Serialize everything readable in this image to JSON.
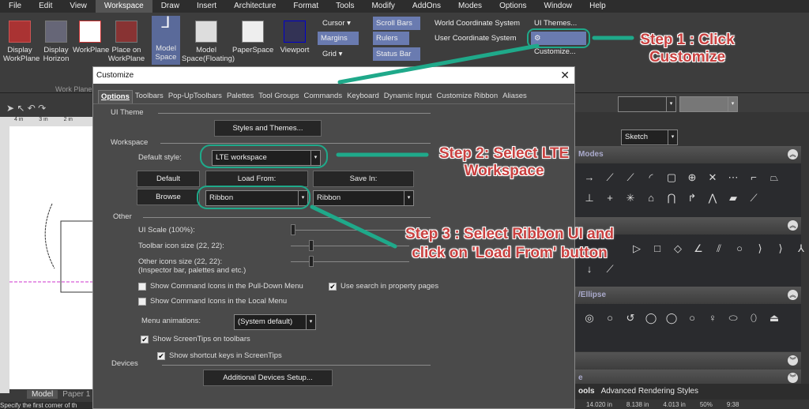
{
  "menubar": [
    "File",
    "Edit",
    "View",
    "Workspace",
    "Draw",
    "Insert",
    "Architecture",
    "Format",
    "Tools",
    "Modify",
    "AddOns",
    "Modes",
    "Options",
    "Window",
    "Help"
  ],
  "menubar_active": "Workspace",
  "ribbon": {
    "workplane_buttons": [
      "Display WorkPlane",
      "Display Horizon",
      "WorkPlane",
      "Place on WorkPlane"
    ],
    "group_label": "Work Plane",
    "space_buttons": [
      "Model Space",
      "Model Space(Floating)",
      "PaperSpace",
      "Viewport"
    ],
    "small": {
      "cursor": "Cursor",
      "margins": "Margins",
      "grid": "Grid",
      "scroll_bars": "Scroll Bars",
      "rulers": "Rulers",
      "status_bar": "Status Bar",
      "wcs": "World Coordinate System",
      "ucs": "User Coordinate System",
      "ui_themes": "UI Themes...",
      "customize": "Customize..."
    }
  },
  "canvas": {
    "tabs": [
      "Model",
      "Paper 1"
    ],
    "status": "Specify the first corner of th",
    "ruler": [
      "4 in",
      "3 in",
      "2 in"
    ]
  },
  "dialog": {
    "title": "Customize",
    "tabs": [
      "Options",
      "Toolbars",
      "Pop-UpToolbars",
      "Palettes",
      "Tool Groups",
      "Commands",
      "Keyboard",
      "Dynamic Input",
      "Customize Ribbon",
      "Aliases"
    ],
    "active_tab": "Options",
    "ui_theme": {
      "label": "UI Theme",
      "button": "Styles and Themes..."
    },
    "workspace": {
      "label": "Workspace",
      "default_style_label": "Default style:",
      "default_style_value": "LTE workspace",
      "default_btn": "Default",
      "load_btn": "Load From:",
      "save_btn": "Save In:",
      "browse_btn": "Browse",
      "load_value": "Ribbon",
      "save_value": "Ribbon"
    },
    "other": {
      "label": "Other",
      "ui_scale": "UI Scale (100%):",
      "ui_scale_level": 0,
      "toolbar_icon": "Toolbar icon size (22, 22):",
      "toolbar_icon_level": 0.15,
      "other_icons": "Other icons size (22, 22):",
      "other_icons_note": "(Inspector bar, palettes and etc.)",
      "other_icons_level": 0.15,
      "checks": [
        {
          "label": "Show Command Icons in the Pull-Down Menu",
          "checked": false
        },
        {
          "label": "Use search in property pages",
          "checked": true
        },
        {
          "label": "Show Command Icons in the Local Menu",
          "checked": false
        },
        {
          "label": "Show ScreenTips on toolbars",
          "checked": true
        },
        {
          "label": "Show shortcut keys in ScreenTips",
          "checked": true
        }
      ],
      "menu_anim_label": "Menu animations:",
      "menu_anim_value": "(System default)"
    },
    "devices": {
      "label": "Devices",
      "button": "Additional Devices Setup..."
    }
  },
  "right": {
    "style_value": "Sketch",
    "panel1": "Modes",
    "panel3": "/Ellipse",
    "panel5": "e",
    "bottom_tabs": [
      "ools",
      "Advanced Rendering Styles"
    ],
    "coords": [
      "14.020 in",
      "8.138 in",
      "4.013 in"
    ],
    "zoom": "50%",
    "time": "9:38"
  },
  "annotations": {
    "step1": "Step 1 : Click Customize",
    "step2": "Step 2: Select LTE Workspace",
    "step3a": "Step 3 : Select Ribbon UI and",
    "step3b": "click on 'Load From' button",
    "arrow_color": "#1fa98a",
    "text_color": "#c9403f"
  }
}
